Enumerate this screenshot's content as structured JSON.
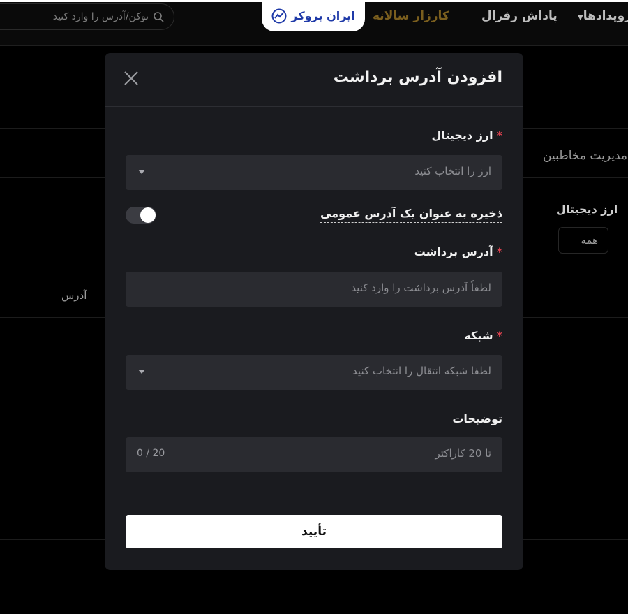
{
  "header": {
    "search_placeholder": "توکن/آدرس را وارد کنید",
    "nav_events": "رویدادها",
    "nav_referral": "پاداش رفرال",
    "nav_anniversary": "کارزار سالانه",
    "logo_text": "ایران بروکر"
  },
  "background": {
    "tab_contacts": "مدیریت مخاطبین",
    "filter_label": "ارز دیجیتال",
    "filter_value": "همه",
    "column_address": "آدرس"
  },
  "modal": {
    "title": "افزودن آدرس برداشت",
    "currency": {
      "label": "ارز دیجیتال",
      "required_mark": "*",
      "placeholder": "ارز را انتخاب کنید"
    },
    "save_public": {
      "label": "ذخیره به عنوان یک آدرس عمومی",
      "enabled": true
    },
    "address": {
      "label": "آدرس برداشت",
      "required_mark": "*",
      "placeholder": "لطفاً آدرس برداشت را وارد کنید"
    },
    "network": {
      "label": "شبکه",
      "required_mark": "*",
      "placeholder": "لطفا شبکه انتقال را انتخاب کنید"
    },
    "notes": {
      "label": "توضیحات",
      "placeholder": "تا 20 کاراکتر",
      "counter": "0 / 20"
    },
    "confirm_label": "تأیید"
  },
  "colors": {
    "modal_bg": "#1a1b1f",
    "field_bg": "#2a2b30",
    "required": "#e0424f",
    "logo_blue": "#1f3aa8"
  }
}
